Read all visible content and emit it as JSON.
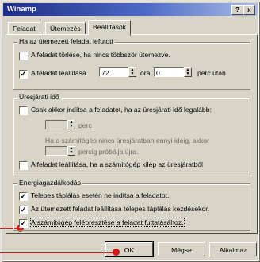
{
  "window": {
    "title": "Winamp",
    "help_label": "?",
    "close_label": "x"
  },
  "tabs": [
    {
      "label": "Feladat",
      "active": false
    },
    {
      "label": "Ütemezés",
      "active": false
    },
    {
      "label": "Beállítások",
      "active": true
    }
  ],
  "group_scheduled": {
    "title": "Ha az ütemezett feladat lefutott",
    "delete_label": "A feladat törlése, ha nincs többször ütemezve.",
    "delete_checked": false,
    "stop_label": "A feladat leállítása",
    "stop_checked": true,
    "hours_value": "72",
    "hours_unit": "óra",
    "minutes_value": "0",
    "minutes_unit": "perc után"
  },
  "group_idle": {
    "title": "Üresjárati idő",
    "start_only_label": "Csak akkor indítsa a feladatot, ha az üresjárati idő legalább:",
    "start_only_checked": false,
    "idle_value": "",
    "idle_unit": "perc",
    "retry_text": "Ha a számítógép nincs üresjáratban ennyi ideig, akkor",
    "retry_value": "",
    "retry_unit": "percig próbálja újra.",
    "stop_idle_label": "A feladat leállítása, ha a számítógép kilép az üresjáratból",
    "stop_idle_checked": false
  },
  "group_power": {
    "title": "Energiagazdálkodás",
    "battery_label": "Telepes táplálás esetén ne indítsa a feladatot.",
    "battery_checked": true,
    "battery_stop_label": "Az ütemezett feladat leállítása telepes táplálás kezdésekor.",
    "battery_stop_checked": true,
    "wake_label": "A számítógép felébresztése a feladat futtatásához.",
    "wake_checked": true
  },
  "buttons": {
    "ok": "OK",
    "cancel": "Mégse",
    "apply": "Alkalmaz"
  },
  "colors": {
    "marker": "#d81818",
    "title_start": "#1e2f86"
  }
}
